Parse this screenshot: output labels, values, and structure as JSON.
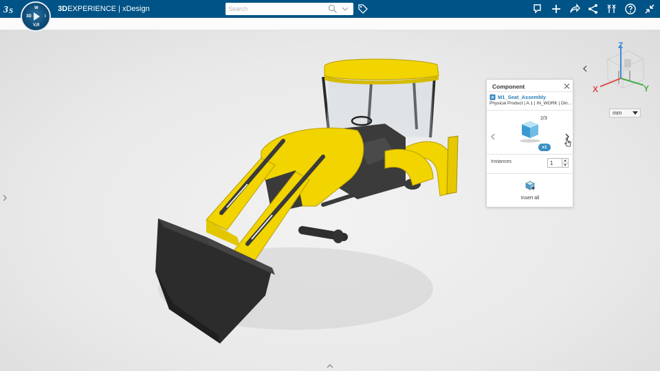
{
  "topbar": {
    "brand_bold": "3D",
    "brand_rest": "EXPERIENCE | xDesign",
    "search_placeholder": "Search",
    "compass": {
      "top": "W",
      "left": "3D",
      "right": "i",
      "bottom": "V,R"
    }
  },
  "toolbar_icons": [
    "feedback-icon",
    "add-icon",
    "share-icon",
    "network-icon",
    "compass-app-icon",
    "help-icon",
    "collapse-icon"
  ],
  "triad": {
    "x_label": "X",
    "y_label": "Y",
    "z_label": "Z"
  },
  "units": {
    "selected": "mm"
  },
  "component_panel": {
    "title": "Component",
    "product_name": "M1_Seat_Assembly",
    "product_meta": "Physical Product | A.1 | IN_WORK | Din...",
    "page_indicator": "2/3",
    "quantity_badge": "x1",
    "instances_label": "Instances",
    "instances_value": "1",
    "insert_label": "Insert all"
  },
  "colors": {
    "topbar": "#005386",
    "machine_yellow": "#f1d400",
    "accent_blue": "#2d7fb7",
    "axis_x": "#e04848",
    "axis_y": "#3fae4a",
    "axis_z": "#3f88d1"
  }
}
